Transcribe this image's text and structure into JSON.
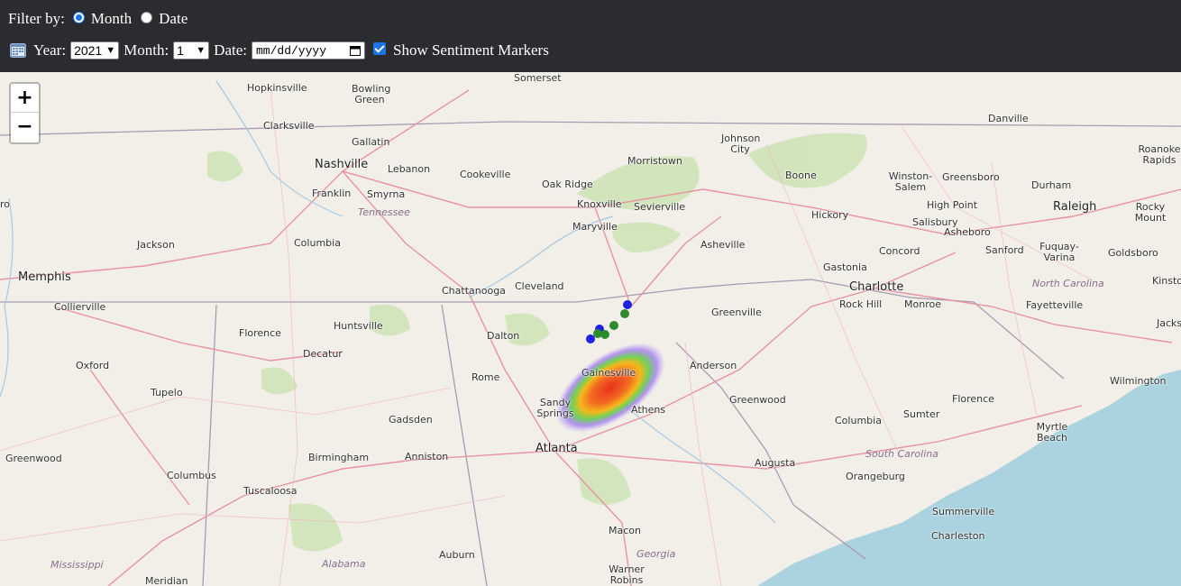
{
  "filter": {
    "label": "Filter by:",
    "option_month": "Month",
    "option_date": "Date",
    "selected": "Month"
  },
  "controls": {
    "calendar_icon": "calendar-icon",
    "year_label": "Year:",
    "year_value": "2021",
    "month_label": "Month:",
    "month_value": "1",
    "date_label": "Date:",
    "date_placeholder": "mm/dd/yyyy",
    "sentiment_checked": true,
    "sentiment_label": "Show Sentiment Markers"
  },
  "map": {
    "zoom_in": "+",
    "zoom_out": "−",
    "cities": [
      "Somerset",
      "Hopkinsville",
      "Bowling Green",
      "Clarksville",
      "Gallatin",
      "Nashville",
      "Lebanon",
      "Cookeville",
      "Franklin",
      "Smyrna",
      "Jackson",
      "Columbia",
      "Memphis",
      "Collierville",
      "Oak Ridge",
      "Knoxville",
      "Sevierville",
      "Maryville",
      "Morristown",
      "Johnson City",
      "Boone",
      "Danville",
      "Winston-Salem",
      "Greensboro",
      "Durham",
      "Roanoke Rapids",
      "High Point",
      "Raleigh",
      "Rocky Mount",
      "Hickory",
      "Salisbury",
      "Asheboro",
      "Asheville",
      "Chattanooga",
      "Cleveland",
      "Gastonia",
      "Charlotte",
      "Concord",
      "Sanford",
      "Fuquay-Varina",
      "Goldsboro",
      "Kinston",
      "Rock Hill",
      "Monroe",
      "Fayetteville",
      "Jacks",
      "Greenville",
      "Huntsville",
      "Florence",
      "Decatur",
      "Dalton",
      "Gainesville",
      "Anderson",
      "Oxford",
      "Tupelo",
      "Rome",
      "Greenwood",
      "Gadsden",
      "Sandy Springs",
      "Athens",
      "Columbia",
      "Sumter",
      "Florence",
      "Wilmington",
      "Myrtle Beach",
      "Atlanta",
      "Greenwood",
      "Columbus",
      "Birmingham",
      "Anniston",
      "Augusta",
      "Orangeburg",
      "Tuscaloosa",
      "Summerville",
      "Charleston",
      "Macon",
      "Auburn",
      "Warner Robins",
      "Meridian",
      "ro"
    ],
    "states": [
      "Tennessee",
      "North Carolina",
      "South Carolina",
      "Georgia",
      "Alabama",
      "Mississippi"
    ],
    "heat_colors": [
      "#7b3fe4",
      "#39c75a",
      "#f59d1c",
      "#e8321e"
    ],
    "marker_colors": {
      "positive": "#2e8b2e",
      "negative": "#2020e0"
    }
  }
}
